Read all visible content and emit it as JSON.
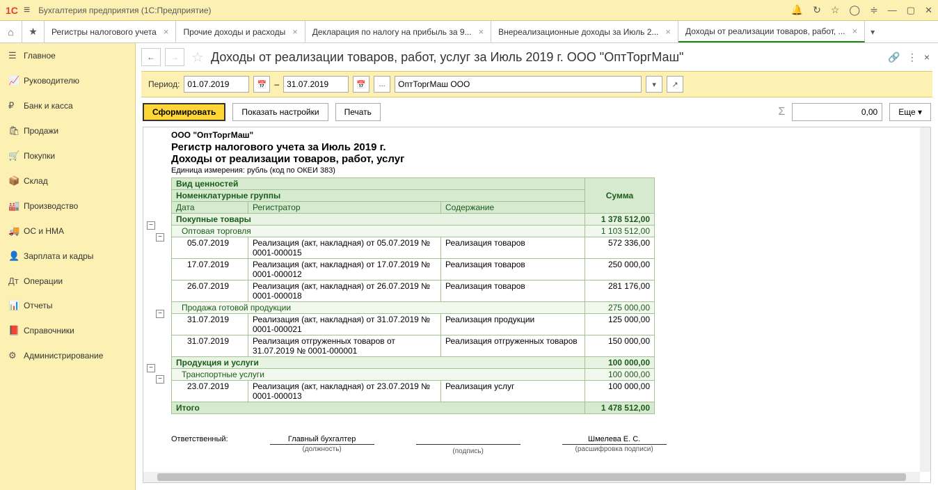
{
  "titlebar": {
    "title": "Бухгалтерия предприятия  (1С:Предприятие)"
  },
  "tabs": [
    {
      "label": "Регистры налогового учета"
    },
    {
      "label": "Прочие доходы и расходы"
    },
    {
      "label": "Декларация по налогу на прибыль за 9..."
    },
    {
      "label": "Внереализационные доходы за Июль 2..."
    },
    {
      "label": "Доходы от реализации товаров, работ, ...",
      "active": true
    }
  ],
  "sidebar": {
    "items": [
      "Главное",
      "Руководителю",
      "Банк и касса",
      "Продажи",
      "Покупки",
      "Склад",
      "Производство",
      "ОС и НМА",
      "Зарплата и кадры",
      "Операции",
      "Отчеты",
      "Справочники",
      "Администрирование"
    ]
  },
  "page": {
    "title": "Доходы от реализации товаров, работ, услуг за Июль 2019 г. ООО \"ОптТоргМаш\""
  },
  "filter": {
    "period_label": "Период:",
    "date_from": "01.07.2019",
    "dash": "–",
    "date_to": "31.07.2019",
    "dots": "...",
    "org": "ОптТоргМаш ООО"
  },
  "toolbar": {
    "form": "Сформировать",
    "show_settings": "Показать настройки",
    "print": "Печать",
    "sum": "0,00",
    "more": "Еще"
  },
  "report": {
    "org": "ООО \"ОптТоргМаш\"",
    "line1": "Регистр налогового учета за Июль 2019 г.",
    "line2": "Доходы от реализации товаров, работ, услуг",
    "unit": "Единица измерения:   рубль (код по ОКЕИ 383)",
    "headers": {
      "h1": "Вид ценностей",
      "h2": "Номенклатурные группы",
      "date": "Дата",
      "reg": "Регистратор",
      "cont": "Содержание",
      "sum": "Сумма"
    },
    "g1": {
      "name": "Покупные товары",
      "sum": "1 378 512,00"
    },
    "g1s1": {
      "name": "Оптовая торговля",
      "sum": "1 103 512,00"
    },
    "g1s1r": [
      {
        "date": "05.07.2019",
        "reg": "Реализация (акт, накладная) от 05.07.2019 № 0001-000015",
        "cont": "Реализация товаров",
        "sum": "572 336,00"
      },
      {
        "date": "17.07.2019",
        "reg": "Реализация (акт, накладная) от 17.07.2019 № 0001-000012",
        "cont": "Реализация товаров",
        "sum": "250 000,00"
      },
      {
        "date": "26.07.2019",
        "reg": "Реализация (акт, накладная) от 26.07.2019 № 0001-000018",
        "cont": "Реализация товаров",
        "sum": "281 176,00"
      }
    ],
    "g1s2": {
      "name": "Продажа готовой продукции",
      "sum": "275 000,00"
    },
    "g1s2r": [
      {
        "date": "31.07.2019",
        "reg": "Реализация (акт, накладная) от 31.07.2019 № 0001-000021",
        "cont": "Реализация продукции",
        "sum": "125 000,00"
      },
      {
        "date": "31.07.2019",
        "reg": "Реализация отгруженных товаров от 31.07.2019 № 0001-000001",
        "cont": "Реализация отгруженных товаров",
        "sum": "150 000,00"
      }
    ],
    "g2": {
      "name": "Продукция и услуги",
      "sum": "100 000,00"
    },
    "g2s1": {
      "name": "Транспортные услуги",
      "sum": "100 000,00"
    },
    "g2s1r": [
      {
        "date": "23.07.2019",
        "reg": "Реализация (акт, накладная) от 23.07.2019 № 0001-000013",
        "cont": "Реализация услуг",
        "sum": "100 000,00"
      }
    ],
    "total": {
      "label": "Итого",
      "sum": "1 478 512,00"
    },
    "sig": {
      "resp": "Ответственный:",
      "pos": "Главный бухгалтер",
      "pos_d": "(должность)",
      "sign_d": "(подпись)",
      "name": "Шмелева Е. С.",
      "name_d": "(расшифровка подписи)"
    }
  }
}
